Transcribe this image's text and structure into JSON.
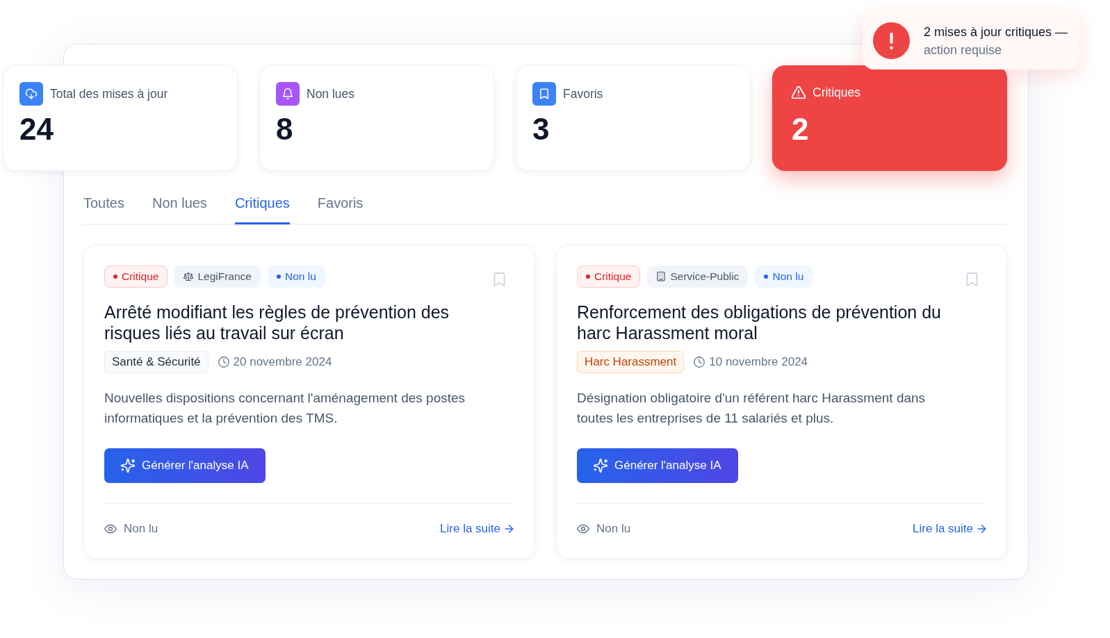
{
  "toast": {
    "title": "2 mises à jour critiques —",
    "subtitle": "action requise"
  },
  "stats": [
    {
      "kind": "total",
      "label": "Total des mises à jour",
      "value": "24"
    },
    {
      "kind": "unread",
      "label": "Non lues",
      "value": "8"
    },
    {
      "kind": "favorites",
      "label": "Favoris",
      "value": "3"
    },
    {
      "kind": "critical",
      "label": "Critiques",
      "value": "2"
    }
  ],
  "tabs": [
    {
      "label": "Toutes",
      "selected": false
    },
    {
      "label": "Non lues",
      "selected": false
    },
    {
      "label": "Critiques",
      "selected": true
    },
    {
      "label": "Favoris",
      "selected": false
    }
  ],
  "articles": [
    {
      "badges": [
        {
          "kind": "priority",
          "label": "Critique"
        },
        {
          "kind": "legislation",
          "label": "LegiFrance"
        },
        {
          "kind": "status",
          "label": "Non lu"
        }
      ],
      "bookmarked": false,
      "title": "Arrêté modifiant les règles de prévention des risques liés au travail sur écran",
      "category": {
        "kind": "neutral",
        "label": "Santé & Sécurité"
      },
      "date": "20 novembre 2024",
      "description": "Nouvelles dispositions concernant l'aménagement des postes informatiques et la prévention des TMS.",
      "action": "Générer l'analyse IA",
      "read_status": "Non lu",
      "link": "Lire la suite"
    },
    {
      "badges": [
        {
          "kind": "priority",
          "label": "Critique"
        },
        {
          "kind": "administration",
          "label": "Service-Public"
        },
        {
          "kind": "status",
          "label": "Non lu"
        }
      ],
      "bookmarked": false,
      "title": "Renforcement des obligations de prévention du harc Harassment moral",
      "category": {
        "kind": "warning",
        "label": "Harc Harassment"
      },
      "date": "10 novembre 2024",
      "description": "Désignation obligatoire d'un référent harc Harassment dans toutes les entreprises de 11 salariés et plus.",
      "action": "Générer l'analyse IA",
      "read_status": "Non lu",
      "link": "Lire la suite"
    }
  ]
}
